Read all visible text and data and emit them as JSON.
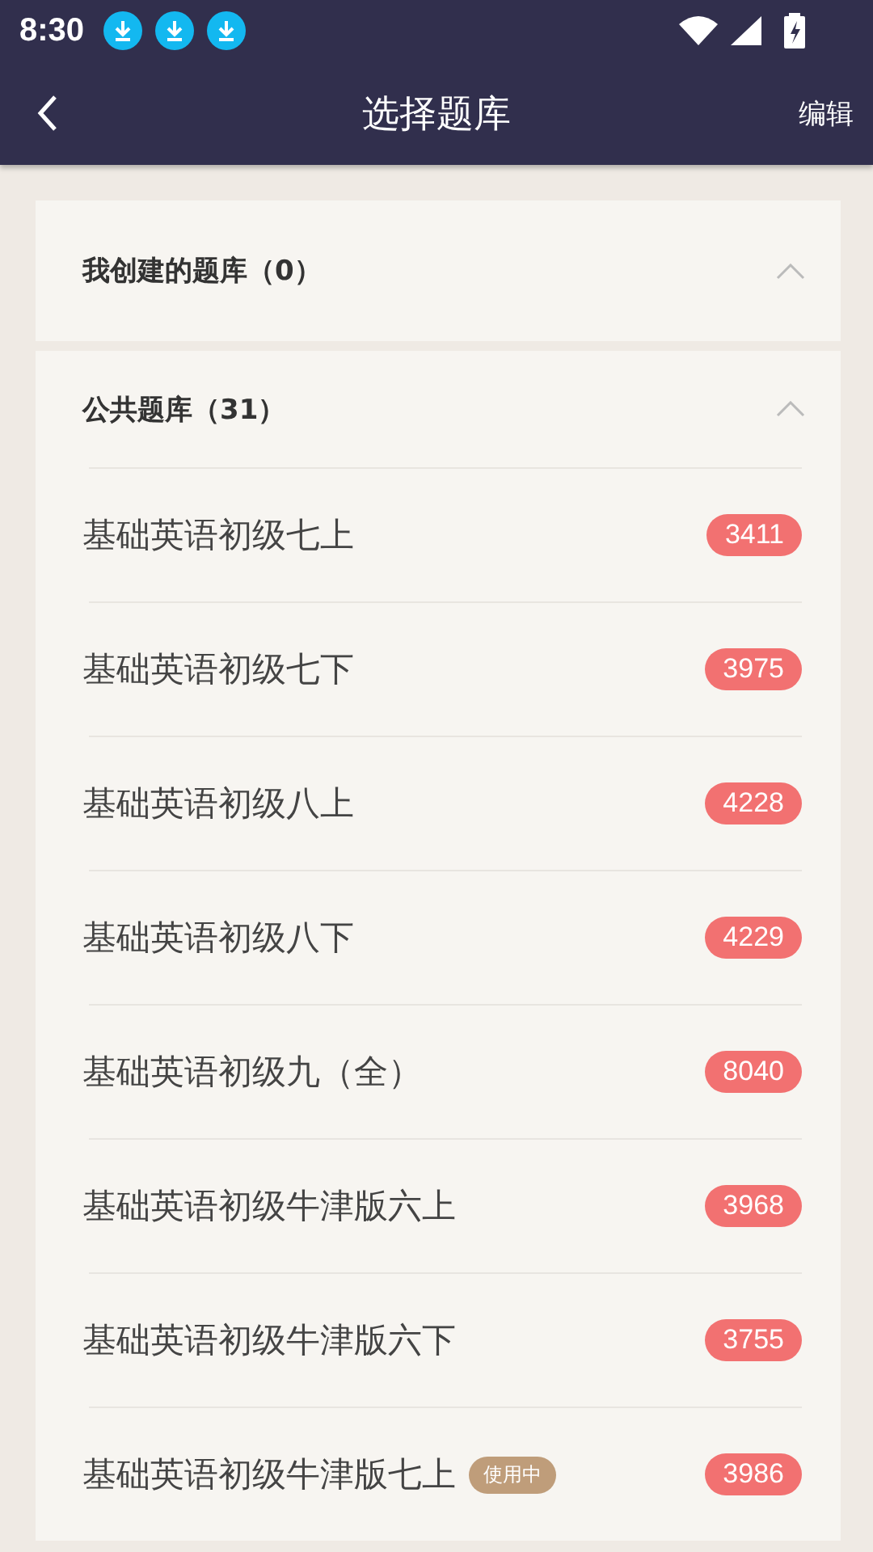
{
  "status_bar": {
    "time": "8:30",
    "notifications": [
      {
        "kind": "download"
      },
      {
        "kind": "download"
      },
      {
        "kind": "download"
      }
    ]
  },
  "header": {
    "title": "选择题库",
    "action": "编辑"
  },
  "sections": [
    {
      "title": "我创建的题库（0）",
      "expanded": true
    },
    {
      "title": "公共题库（31）",
      "expanded": true,
      "items": [
        {
          "name": "基础英语初级七上",
          "count": "3411"
        },
        {
          "name": "基础英语初级七下",
          "count": "3975"
        },
        {
          "name": "基础英语初级八上",
          "count": "4228"
        },
        {
          "name": "基础英语初级八下",
          "count": "4229"
        },
        {
          "name": "基础英语初级九（全）",
          "count": "8040"
        },
        {
          "name": "基础英语初级牛津版六上",
          "count": "3968"
        },
        {
          "name": "基础英语初级牛津版六下",
          "count": "3755"
        },
        {
          "name": "基础英语初级牛津版七上",
          "count": "3986",
          "status": "使用中"
        }
      ]
    }
  ]
}
